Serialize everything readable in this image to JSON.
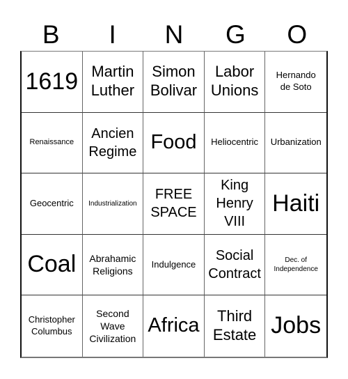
{
  "header": {
    "letters": [
      "B",
      "I",
      "N",
      "G",
      "O"
    ]
  },
  "cells": [
    {
      "text": "1619",
      "size": "s-xl"
    },
    {
      "text": "Martin\nLuther",
      "size": "s-m"
    },
    {
      "text": "Simon\nBolivar",
      "size": "s-m"
    },
    {
      "text": "Labor\nUnions",
      "size": "s-m"
    },
    {
      "text": "Hernando\nde Soto",
      "size": "s-s"
    },
    {
      "text": "Renaissance",
      "size": "s-xs"
    },
    {
      "text": "Ancien\nRegime",
      "size": "s-ms"
    },
    {
      "text": "Food",
      "size": "s-l"
    },
    {
      "text": "Heliocentric",
      "size": "s-s"
    },
    {
      "text": "Urbanization",
      "size": "s-s"
    },
    {
      "text": "Geocentric",
      "size": "s-s"
    },
    {
      "text": "Industrialization",
      "size": "s-xxs"
    },
    {
      "text": "FREE\nSPACE",
      "size": "s-ms"
    },
    {
      "text": "King\nHenry\nVIII",
      "size": "s-ms"
    },
    {
      "text": "Haiti",
      "size": "s-xl"
    },
    {
      "text": "Coal",
      "size": "s-xl"
    },
    {
      "text": "Abrahamic\nReligions",
      "size": "s-sm"
    },
    {
      "text": "Indulgence",
      "size": "s-s"
    },
    {
      "text": "Social\nContract",
      "size": "s-ms"
    },
    {
      "text": "Dec. of\nIndependence",
      "size": "s-xxs"
    },
    {
      "text": "Christopher\nColumbus",
      "size": "s-s"
    },
    {
      "text": "Second\nWave\nCivilization",
      "size": "s-sm"
    },
    {
      "text": "Africa",
      "size": "s-l"
    },
    {
      "text": "Third\nEstate",
      "size": "s-m"
    },
    {
      "text": "Jobs",
      "size": "s-xl"
    }
  ]
}
